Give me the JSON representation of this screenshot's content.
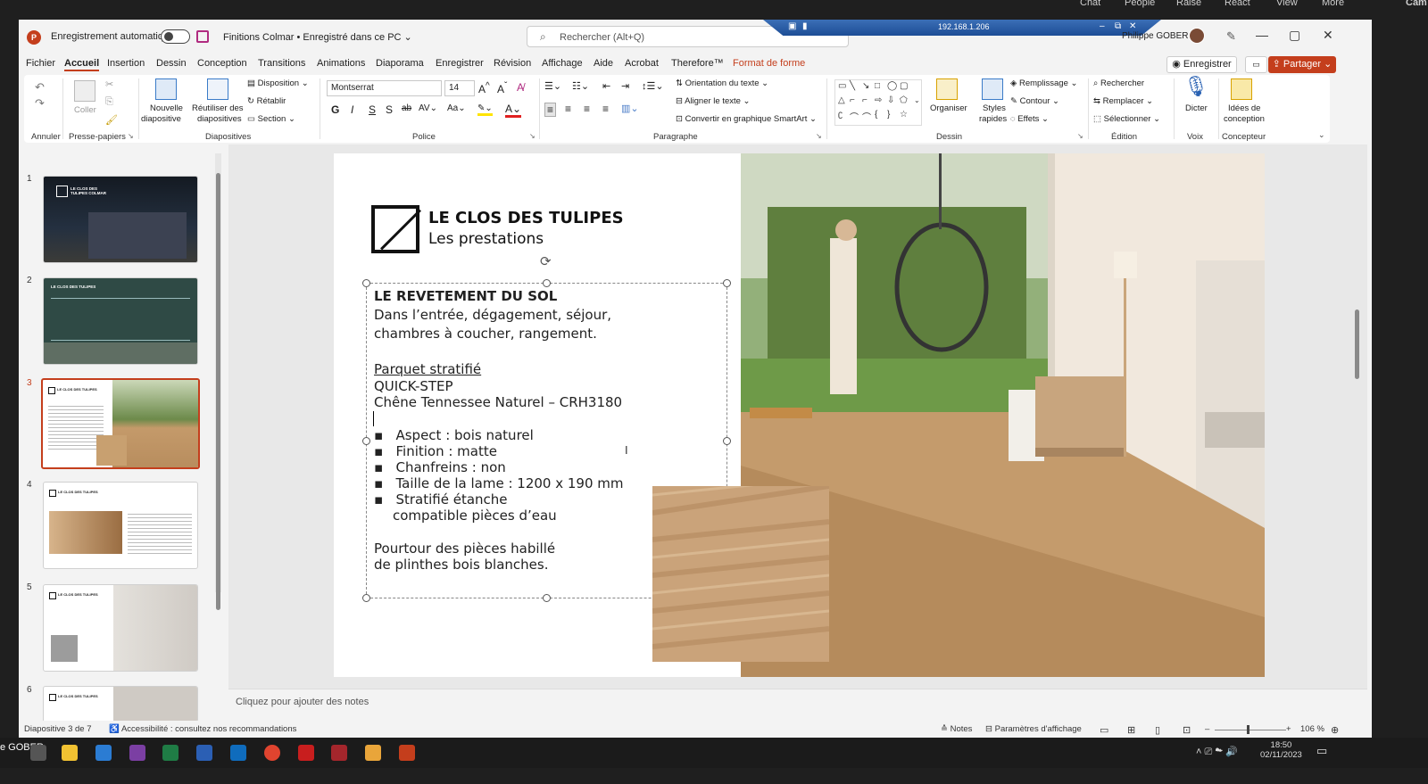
{
  "meeting_bar": {
    "items": [
      "Chat",
      "People",
      "Raise",
      "React",
      "View",
      "More"
    ],
    "edge": "Cam"
  },
  "window": {
    "autosave_label": "Enregistrement automatique",
    "doc_title": "Finitions Colmar • Enregistré dans ce PC",
    "doc_title_chevron": "⌄",
    "search_placeholder": "Rechercher (Alt+Q)",
    "remote_ip": "192.168.1.206",
    "user_name": "Philippe GOBER",
    "minimize": "—",
    "restore": "▢",
    "close": "✕"
  },
  "tabs": [
    "Fichier",
    "Accueil",
    "Insertion",
    "Dessin",
    "Conception",
    "Transitions",
    "Animations",
    "Diaporama",
    "Enregistrer",
    "Révision",
    "Affichage",
    "Aide",
    "Acrobat",
    "Therefore™",
    "Format de forme"
  ],
  "top_buttons": {
    "record": "Enregistrer",
    "share": "Partager"
  },
  "ribbon": {
    "annuler": "Annuler",
    "presse_papiers": "Presse-papiers",
    "coller": "Coller",
    "nouvelle_diapositive": [
      "Nouvelle",
      "diapositive"
    ],
    "reutiliser": [
      "Réutiliser des",
      "diapositives"
    ],
    "disposition": "Disposition",
    "retablir": "Rétablir",
    "section": "Section",
    "diapositives": "Diapositives",
    "font_name": "Montserrat",
    "font_size": "14",
    "police": "Police",
    "paragraphe": "Paragraphe",
    "orientation": "Orientation du texte",
    "aligner": "Aligner le texte",
    "smartart": "Convertir en graphique SmartArt",
    "organiser": "Organiser",
    "styles_rapides": [
      "Styles",
      "rapides"
    ],
    "remplissage": "Remplissage",
    "contour": "Contour",
    "effets": "Effets",
    "dessin": "Dessin",
    "rechercher": "Rechercher",
    "remplacer": "Remplacer",
    "selectionner": "Sélectionner",
    "edition": "Édition",
    "dicter": "Dicter",
    "voix": "Voix",
    "idees": [
      "Idées de",
      "conception"
    ],
    "concepteur": "Concepteur"
  },
  "thumbnails": [
    {
      "num": "1",
      "title": "LE CLOS DES TULIPES COLMAR"
    },
    {
      "num": "2",
      "title": "LE CLOS DES TULIPES"
    },
    {
      "num": "3",
      "title": "LE CLOS DES TULIPES"
    },
    {
      "num": "4",
      "title": "LE CLOS DES TULIPES"
    },
    {
      "num": "5",
      "title": "LE CLOS DES TULIPES"
    },
    {
      "num": "6",
      "title": "LE CLOS DES TULIPES"
    }
  ],
  "slide": {
    "title": "LE CLOS DES TULIPES",
    "subtitle": "Les prestations",
    "heading": "LE REVETEMENT DU SOL",
    "line1": "Dans l’entrée, dégagement, séjour,",
    "line2": "chambres à coucher, rangement.",
    "product_label": "Parquet stratifié",
    "brand": "QUICK-STEP",
    "reference": "Chêne Tennessee Naturel – CRH3180",
    "bullets": [
      "Aspect : bois naturel",
      "Finition : matte",
      "Chanfreins : non",
      "Taille de la lame : 1200 x 190 mm",
      "Stratifié étanche"
    ],
    "bullet_cont": "compatible pièces d’eau",
    "footer1": "Pourtour des pièces habillé",
    "footer2": "de plinthes bois blanches."
  },
  "notes_placeholder": "Cliquez pour ajouter des notes",
  "status": {
    "slide_count": "Diapositive 3 de 7",
    "accessibility": "Accessibilité : consultez nos recommandations",
    "notes": "Notes",
    "display": "Paramètres d'affichage",
    "zoom": "106 %"
  },
  "taskbar": {
    "time": "18:50",
    "date": "02/11/2023",
    "user_edge": "e GOBER"
  },
  "colors": {
    "accent": "#c43e1c",
    "ribbon_bg": "#ffffff",
    "window_bg": "#f3f3f3"
  }
}
